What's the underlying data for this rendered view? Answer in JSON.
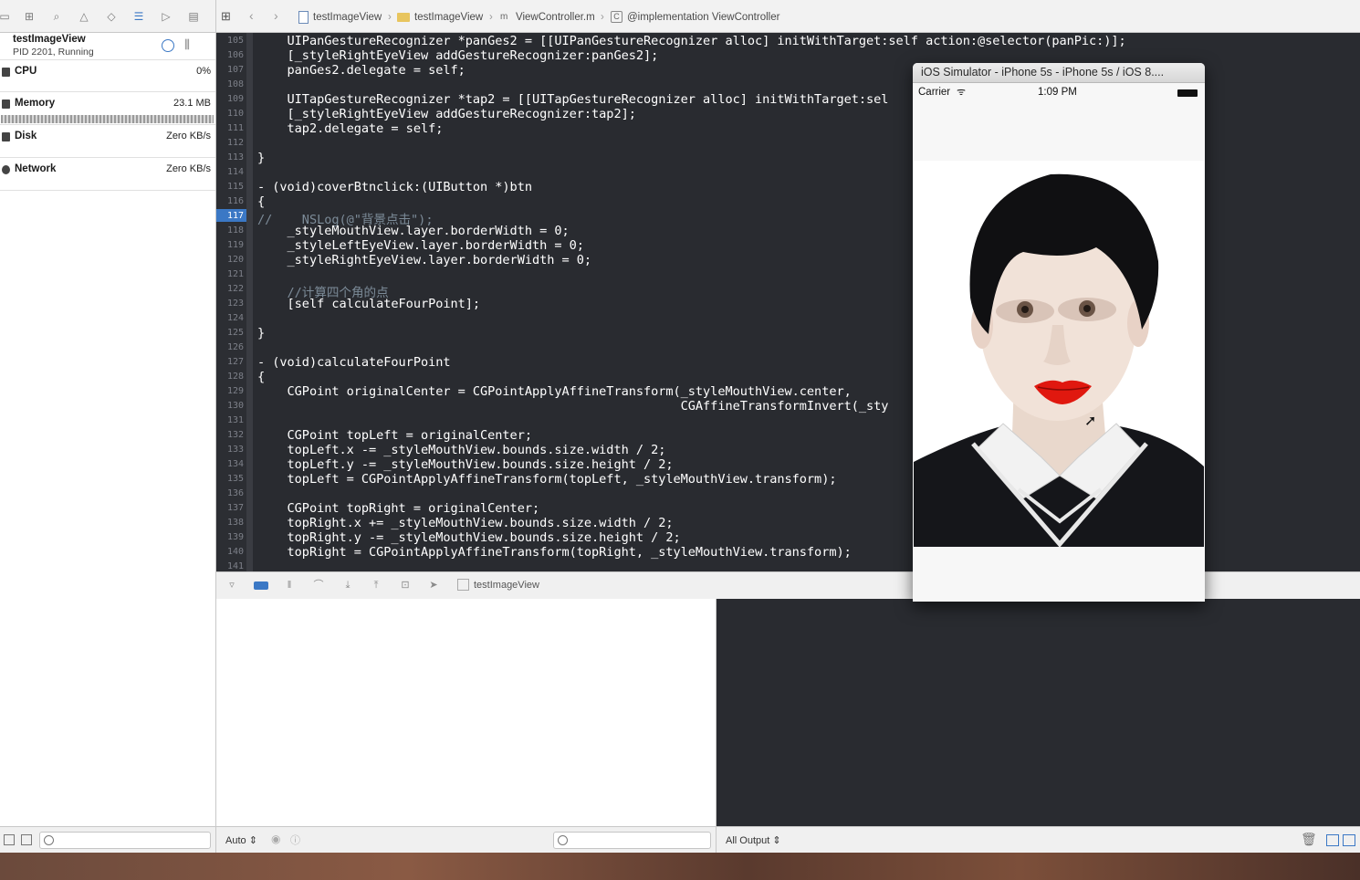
{
  "toolbar": {
    "breadcrumb": [
      "testImageView",
      "testImageView",
      "ViewController.m",
      "@implementation ViewController"
    ]
  },
  "debug_navigator": {
    "process_name": "testImageView",
    "process_status": "PID 2201, Running",
    "gauges": [
      {
        "label": "CPU",
        "value": "0%"
      },
      {
        "label": "Memory",
        "value": "23.1 MB"
      },
      {
        "label": "Disk",
        "value": "Zero KB/s"
      },
      {
        "label": "Network",
        "value": "Zero KB/s"
      }
    ]
  },
  "editor": {
    "current_line": "117",
    "line_numbers": [
      "105",
      "106",
      "107",
      "108",
      "109",
      "110",
      "111",
      "112",
      "113",
      "114",
      "115",
      "116",
      "117",
      "118",
      "119",
      "120",
      "121",
      "122",
      "123",
      "124",
      "125",
      "126",
      "127",
      "128",
      "129",
      "130",
      "131",
      "132",
      "133",
      "134",
      "135",
      "136",
      "137",
      "138",
      "139",
      "140",
      "141"
    ],
    "code_text": [
      "    UIPanGestureRecognizer *panGes2 = [[UIPanGestureRecognizer alloc] initWithTarget:self action:@selector(panPic:)];",
      "    [_styleRightEyeView addGestureRecognizer:panGes2];",
      "    panGes2.delegate = self;",
      "",
      "    UITapGestureRecognizer *tap2 = [[UITapGestureRecognizer alloc] initWithTarget:sel",
      "    [_styleRightEyeView addGestureRecognizer:tap2];",
      "    tap2.delegate = self;",
      "",
      "}",
      "",
      "- (void)coverBtnclick:(UIButton *)btn",
      "{",
      "//    NSLog(@\"背景点击\");",
      "    _styleMouthView.layer.borderWidth = 0;",
      "    _styleLeftEyeView.layer.borderWidth = 0;",
      "    _styleRightEyeView.layer.borderWidth = 0;",
      "",
      "    //计算四个角的点",
      "    [self calculateFourPoint];",
      "",
      "}",
      "",
      "- (void)calculateFourPoint",
      "{",
      "    CGPoint originalCenter = CGPointApplyAffineTransform(_styleMouthView.center,",
      "                                                         CGAffineTransformInvert(_sty",
      "",
      "    CGPoint topLeft = originalCenter;",
      "    topLeft.x -= _styleMouthView.bounds.size.width / 2;",
      "    topLeft.y -= _styleMouthView.bounds.size.height / 2;",
      "    topLeft = CGPointApplyAffineTransform(topLeft, _styleMouthView.transform);",
      "",
      "    CGPoint topRight = originalCenter;",
      "    topRight.x += _styleMouthView.bounds.size.width / 2;",
      "    topRight.y -= _styleMouthView.bounds.size.height / 2;",
      "    topRight = CGPointApplyAffineTransform(topRight, _styleMouthView.transform);",
      ""
    ]
  },
  "debug_bar": {
    "scheme_target": "testImageView"
  },
  "variables_view": {
    "scope": "Auto"
  },
  "console": {
    "output_filter": "All Output"
  },
  "simulator": {
    "title": "iOS Simulator - iPhone 5s - iPhone 5s / iOS 8....",
    "carrier": "Carrier",
    "time": "1:09 PM"
  }
}
